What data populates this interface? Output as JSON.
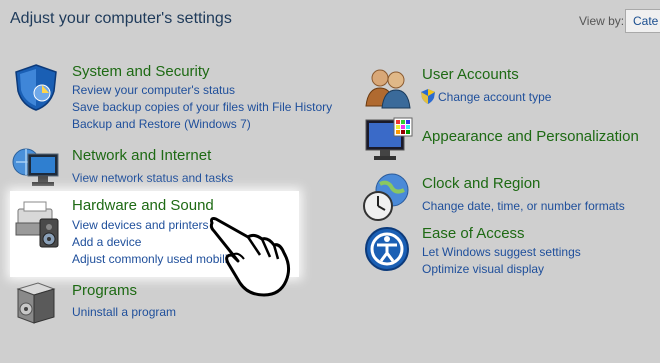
{
  "header": {
    "title": "Adjust your computer's settings",
    "view_by_label": "View by:",
    "view_by_value": "Cate"
  },
  "left": {
    "system": {
      "title": "System and Security",
      "links": [
        "Review your computer's status",
        "Save backup copies of your files with File History",
        "Backup and Restore (Windows 7)"
      ]
    },
    "network": {
      "title": "Network and Internet",
      "links": [
        "View network status and tasks"
      ]
    },
    "hardware": {
      "title": "Hardware and Sound",
      "links": [
        "View devices and printers",
        "Add a device",
        "Adjust commonly used mobility settings"
      ]
    },
    "programs": {
      "title": "Programs",
      "links": [
        "Uninstall a program"
      ]
    }
  },
  "right": {
    "users": {
      "title": "User Accounts",
      "links": [
        "Change account type"
      ]
    },
    "appearance": {
      "title": "Appearance and Personalization",
      "links": []
    },
    "clock": {
      "title": "Clock and Region",
      "links": [
        "Change date, time, or number formats"
      ]
    },
    "ease": {
      "title": "Ease of Access",
      "links": [
        "Let Windows suggest settings",
        "Optimize visual display"
      ]
    }
  },
  "icons": {
    "system": "shield-icon",
    "network": "network-monitor-icon",
    "hardware": "printer-speaker-icon",
    "programs": "programs-box-icon",
    "users": "users-icon",
    "appearance": "monitor-palette-icon",
    "clock": "globe-clock-icon",
    "ease": "ease-of-access-icon",
    "pointer": "hand-pointer-icon"
  }
}
